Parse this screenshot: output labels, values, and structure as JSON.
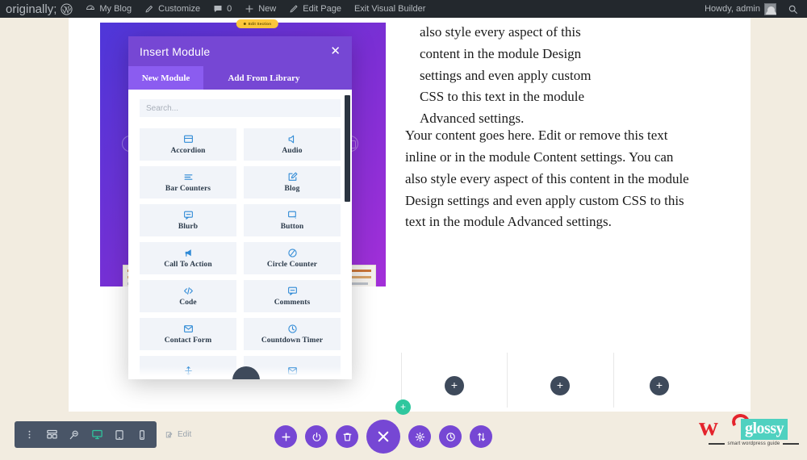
{
  "adminbar": {
    "logo_icon": "wordpress-logo-icon",
    "items": [
      {
        "icon": "dashboard-icon",
        "label": "My Blog"
      },
      {
        "icon": "customize-brush-icon",
        "label": "Customize"
      },
      {
        "icon": "comment-bubble-icon",
        "label": "0"
      },
      {
        "icon": "plus-icon",
        "label": "New"
      },
      {
        "icon": "pencil-icon",
        "label": "Edit Page"
      },
      {
        "icon": "",
        "label": "Exit Visual Builder"
      }
    ],
    "howdy": "Howdy, admin",
    "avatar_icon": "user-avatar-icon",
    "search_icon": "search-icon"
  },
  "modal": {
    "title": "Insert Module",
    "close_icon": "close-icon",
    "tabs": [
      {
        "label": "New Module",
        "active": true
      },
      {
        "label": "Add From Library",
        "active": false
      }
    ],
    "search": {
      "placeholder": "Search...",
      "value": ""
    },
    "modules": [
      {
        "label": "Accordion",
        "icon": "accordion-icon"
      },
      {
        "label": "Audio",
        "icon": "speaker-icon"
      },
      {
        "label": "Bar Counters",
        "icon": "bars-icon"
      },
      {
        "label": "Blog",
        "icon": "blog-pencil-icon"
      },
      {
        "label": "Blurb",
        "icon": "speech-bubble-icon"
      },
      {
        "label": "Button",
        "icon": "cursor-click-icon"
      },
      {
        "label": "Call To Action",
        "icon": "megaphone-icon"
      },
      {
        "label": "Circle Counter",
        "icon": "circle-slash-icon"
      },
      {
        "label": "Code",
        "icon": "code-brackets-icon"
      },
      {
        "label": "Comments",
        "icon": "comment-icon"
      },
      {
        "label": "Contact Form",
        "icon": "envelope-icon"
      },
      {
        "label": "Countdown Timer",
        "icon": "clock-icon"
      },
      {
        "label": "",
        "icon": "divider-arrows-icon"
      },
      {
        "label": "",
        "icon": "envelope-icon"
      }
    ],
    "scrollbar": "modal-scrollbar",
    "drag_handle_icon": "drag-handle-icon"
  },
  "content": {
    "section_badge": "Edit Section",
    "paragraph_top": "module Content settings. You can also style every aspect of this content in the module Design settings and even apply custom CSS to this text in the module Advanced settings.",
    "paragraph_main": "Your content goes here. Edit or remove this text inline or in the module Content settings. You can also style every aspect of this content in the module Design settings and even apply custom CSS to this text in the module Advanced settings.",
    "column_add_icon": "plus-icon",
    "edit_hint": "Edit",
    "edit_hint_icon": "edit-pencil-icon"
  },
  "toolbar_left": {
    "items": [
      {
        "icon": "more-vertical-icon",
        "active": false
      },
      {
        "icon": "wireframe-grid-icon",
        "active": false
      },
      {
        "icon": "zoom-out-icon",
        "active": false
      },
      {
        "icon": "desktop-icon",
        "active": true
      },
      {
        "icon": "tablet-icon",
        "active": false
      },
      {
        "icon": "phone-icon",
        "active": false
      }
    ]
  },
  "toolbar_center": {
    "add_badge_icon": "plus-icon",
    "items": [
      {
        "icon": "plus-icon",
        "big": false
      },
      {
        "icon": "power-icon",
        "big": false
      },
      {
        "icon": "trash-icon",
        "big": false
      },
      {
        "icon": "close-x-icon",
        "big": true
      },
      {
        "icon": "gear-icon",
        "big": false
      },
      {
        "icon": "history-clock-icon",
        "big": false
      },
      {
        "icon": "sort-arrows-icon",
        "big": false
      }
    ]
  },
  "logo": {
    "mark": "w",
    "word": "glossy",
    "tagline": "smart wordpress guide"
  },
  "colors": {
    "admin_bar": "#23282d",
    "divi_purple": "#7647d4",
    "accent_green": "#2fc79e",
    "page_bg": "#f2ece0",
    "module_icon_blue": "#2f8ad6",
    "toolbar_slate": "#495567",
    "logo_red": "#e4232c",
    "logo_teal": "#4fd1c0",
    "badge_yellow": "#ffc93c"
  }
}
